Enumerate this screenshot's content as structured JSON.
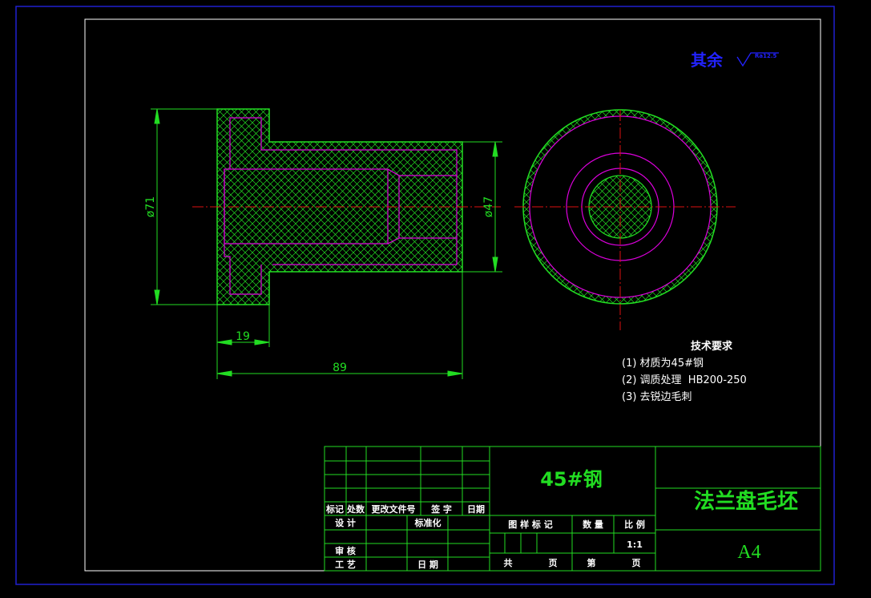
{
  "colors": {
    "background": "#000000",
    "outer_border": "#2020d0",
    "inner_border": "#ffffff",
    "outline": "#22dd22",
    "hidden_lines": "#dd00dd",
    "centerline": "#dd1111",
    "text_white": "#ffffff",
    "text_green": "#22dd22",
    "text_blue": "#2222ff"
  },
  "surface_note": {
    "label": "其余",
    "symbol_value": "Ra12.5"
  },
  "dimensions": {
    "dia71": "ø71",
    "dia47": "ø47",
    "len19": "19",
    "len89": "89"
  },
  "tech_requirements": {
    "heading": "技术要求",
    "items": [
      "(1) 材质为45#钢",
      "(2) 调质处理  HB200-250",
      "(3) 去锐边毛刺"
    ]
  },
  "title_block": {
    "material": "45#钢",
    "part_name": "法兰盘毛坯",
    "paper_size": "A4",
    "rev_headers": [
      "标记",
      "处数",
      "更改文件号",
      "签 字",
      "日期"
    ],
    "design": "设 计",
    "standardize": "标准化",
    "review": "审 核",
    "process": "工 艺",
    "date": "日 期",
    "drawing_mark": "图 样 标 记",
    "quantity": "数 量",
    "scale_label": "比 例",
    "scale_value": "1:1",
    "total": "共",
    "page": "页",
    "sheet_no": "第",
    "page2": "页"
  }
}
